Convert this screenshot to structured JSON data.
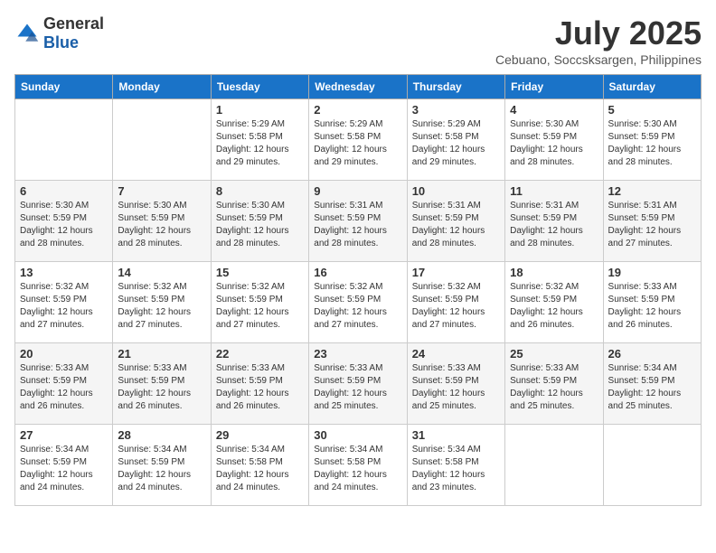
{
  "header": {
    "logo_general": "General",
    "logo_blue": "Blue",
    "month_year": "July 2025",
    "location": "Cebuano, Soccsksargen, Philippines"
  },
  "days_of_week": [
    "Sunday",
    "Monday",
    "Tuesday",
    "Wednesday",
    "Thursday",
    "Friday",
    "Saturday"
  ],
  "weeks": [
    [
      {
        "day": "",
        "info": ""
      },
      {
        "day": "",
        "info": ""
      },
      {
        "day": "1",
        "info": "Sunrise: 5:29 AM\nSunset: 5:58 PM\nDaylight: 12 hours and 29 minutes."
      },
      {
        "day": "2",
        "info": "Sunrise: 5:29 AM\nSunset: 5:58 PM\nDaylight: 12 hours and 29 minutes."
      },
      {
        "day": "3",
        "info": "Sunrise: 5:29 AM\nSunset: 5:58 PM\nDaylight: 12 hours and 29 minutes."
      },
      {
        "day": "4",
        "info": "Sunrise: 5:30 AM\nSunset: 5:59 PM\nDaylight: 12 hours and 28 minutes."
      },
      {
        "day": "5",
        "info": "Sunrise: 5:30 AM\nSunset: 5:59 PM\nDaylight: 12 hours and 28 minutes."
      }
    ],
    [
      {
        "day": "6",
        "info": "Sunrise: 5:30 AM\nSunset: 5:59 PM\nDaylight: 12 hours and 28 minutes."
      },
      {
        "day": "7",
        "info": "Sunrise: 5:30 AM\nSunset: 5:59 PM\nDaylight: 12 hours and 28 minutes."
      },
      {
        "day": "8",
        "info": "Sunrise: 5:30 AM\nSunset: 5:59 PM\nDaylight: 12 hours and 28 minutes."
      },
      {
        "day": "9",
        "info": "Sunrise: 5:31 AM\nSunset: 5:59 PM\nDaylight: 12 hours and 28 minutes."
      },
      {
        "day": "10",
        "info": "Sunrise: 5:31 AM\nSunset: 5:59 PM\nDaylight: 12 hours and 28 minutes."
      },
      {
        "day": "11",
        "info": "Sunrise: 5:31 AM\nSunset: 5:59 PM\nDaylight: 12 hours and 28 minutes."
      },
      {
        "day": "12",
        "info": "Sunrise: 5:31 AM\nSunset: 5:59 PM\nDaylight: 12 hours and 27 minutes."
      }
    ],
    [
      {
        "day": "13",
        "info": "Sunrise: 5:32 AM\nSunset: 5:59 PM\nDaylight: 12 hours and 27 minutes."
      },
      {
        "day": "14",
        "info": "Sunrise: 5:32 AM\nSunset: 5:59 PM\nDaylight: 12 hours and 27 minutes."
      },
      {
        "day": "15",
        "info": "Sunrise: 5:32 AM\nSunset: 5:59 PM\nDaylight: 12 hours and 27 minutes."
      },
      {
        "day": "16",
        "info": "Sunrise: 5:32 AM\nSunset: 5:59 PM\nDaylight: 12 hours and 27 minutes."
      },
      {
        "day": "17",
        "info": "Sunrise: 5:32 AM\nSunset: 5:59 PM\nDaylight: 12 hours and 27 minutes."
      },
      {
        "day": "18",
        "info": "Sunrise: 5:32 AM\nSunset: 5:59 PM\nDaylight: 12 hours and 26 minutes."
      },
      {
        "day": "19",
        "info": "Sunrise: 5:33 AM\nSunset: 5:59 PM\nDaylight: 12 hours and 26 minutes."
      }
    ],
    [
      {
        "day": "20",
        "info": "Sunrise: 5:33 AM\nSunset: 5:59 PM\nDaylight: 12 hours and 26 minutes."
      },
      {
        "day": "21",
        "info": "Sunrise: 5:33 AM\nSunset: 5:59 PM\nDaylight: 12 hours and 26 minutes."
      },
      {
        "day": "22",
        "info": "Sunrise: 5:33 AM\nSunset: 5:59 PM\nDaylight: 12 hours and 26 minutes."
      },
      {
        "day": "23",
        "info": "Sunrise: 5:33 AM\nSunset: 5:59 PM\nDaylight: 12 hours and 25 minutes."
      },
      {
        "day": "24",
        "info": "Sunrise: 5:33 AM\nSunset: 5:59 PM\nDaylight: 12 hours and 25 minutes."
      },
      {
        "day": "25",
        "info": "Sunrise: 5:33 AM\nSunset: 5:59 PM\nDaylight: 12 hours and 25 minutes."
      },
      {
        "day": "26",
        "info": "Sunrise: 5:34 AM\nSunset: 5:59 PM\nDaylight: 12 hours and 25 minutes."
      }
    ],
    [
      {
        "day": "27",
        "info": "Sunrise: 5:34 AM\nSunset: 5:59 PM\nDaylight: 12 hours and 24 minutes."
      },
      {
        "day": "28",
        "info": "Sunrise: 5:34 AM\nSunset: 5:59 PM\nDaylight: 12 hours and 24 minutes."
      },
      {
        "day": "29",
        "info": "Sunrise: 5:34 AM\nSunset: 5:58 PM\nDaylight: 12 hours and 24 minutes."
      },
      {
        "day": "30",
        "info": "Sunrise: 5:34 AM\nSunset: 5:58 PM\nDaylight: 12 hours and 24 minutes."
      },
      {
        "day": "31",
        "info": "Sunrise: 5:34 AM\nSunset: 5:58 PM\nDaylight: 12 hours and 23 minutes."
      },
      {
        "day": "",
        "info": ""
      },
      {
        "day": "",
        "info": ""
      }
    ]
  ]
}
